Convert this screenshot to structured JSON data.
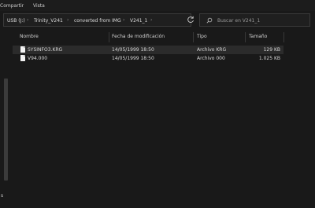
{
  "ribbon": {
    "tabs": [
      "Compartir",
      "Vista"
    ]
  },
  "address": {
    "segments": [
      "USB (J:)",
      "Trinity_V241",
      "converted from IMG",
      "V241_1"
    ],
    "separator": "›"
  },
  "search": {
    "placeholder": "Buscar en V241_1"
  },
  "columns": {
    "name": "Nombre",
    "modified": "Fecha de modificación",
    "type": "Tipo",
    "size": "Tamaño"
  },
  "files": [
    {
      "name": "SYSINFO3.KRG",
      "modified": "14/05/1999 18:50",
      "type": "Archivo KRG",
      "size": "129 KB",
      "selected": true
    },
    {
      "name": "V94.000",
      "modified": "14/05/1999 18:50",
      "type": "Archivo 000",
      "size": "1.025 KB",
      "selected": false
    }
  ],
  "nav_pane": {
    "label": "s"
  },
  "colors": {
    "background": "#191919",
    "selected_row": "#2b2b2b",
    "border": "#3a3a3a"
  }
}
